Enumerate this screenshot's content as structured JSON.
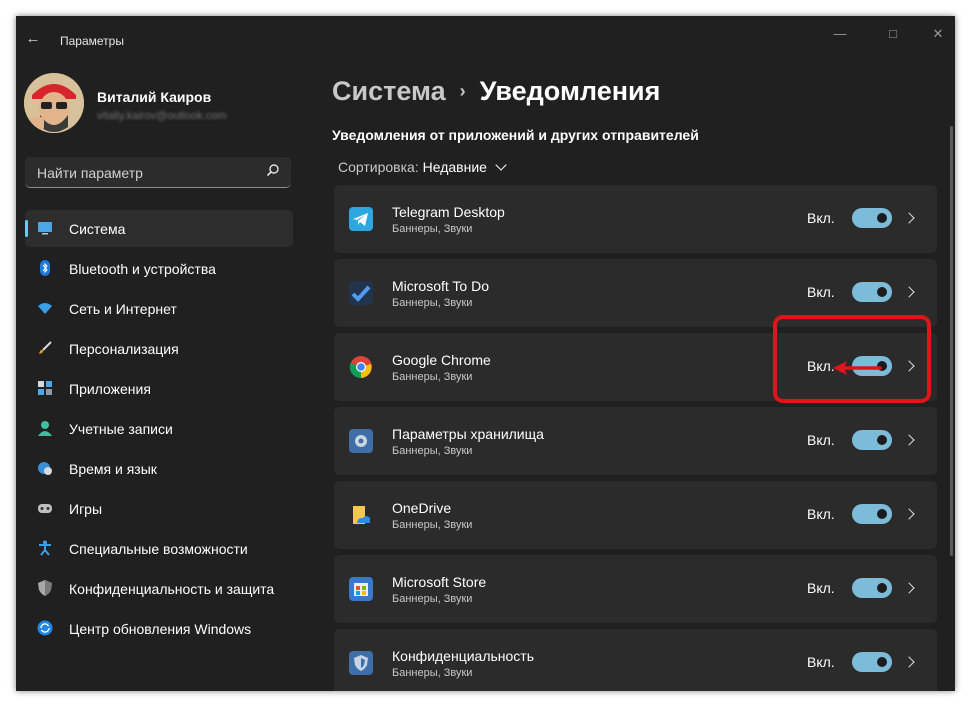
{
  "window": {
    "title": "Параметры"
  },
  "user": {
    "name": "Виталий Каиров",
    "email": "vitaliy.kairov@outlook.com"
  },
  "search": {
    "placeholder": "Найти параметр"
  },
  "nav": [
    {
      "label": "Система",
      "icon": "monitor-icon",
      "active": true
    },
    {
      "label": "Bluetooth и устройства",
      "icon": "bluetooth-icon"
    },
    {
      "label": "Сеть и Интернет",
      "icon": "wifi-icon"
    },
    {
      "label": "Персонализация",
      "icon": "brush-icon"
    },
    {
      "label": "Приложения",
      "icon": "apps-icon"
    },
    {
      "label": "Учетные записи",
      "icon": "person-icon"
    },
    {
      "label": "Время и язык",
      "icon": "globe-clock-icon"
    },
    {
      "label": "Игры",
      "icon": "gamepad-icon"
    },
    {
      "label": "Специальные возможности",
      "icon": "accessibility-icon"
    },
    {
      "label": "Конфиденциальность и защита",
      "icon": "shield-icon"
    },
    {
      "label": "Центр обновления Windows",
      "icon": "update-icon"
    }
  ],
  "breadcrumb": {
    "parent": "Система",
    "current": "Уведомления",
    "separator": "›"
  },
  "section_title": "Уведомления от приложений и других отправителей",
  "sort": {
    "label": "Сортировка:",
    "value": "Недавние"
  },
  "apps": [
    {
      "name": "Telegram Desktop",
      "sub": "Баннеры, Звуки",
      "state": "Вкл.",
      "on": true,
      "icon": "telegram-icon"
    },
    {
      "name": "Microsoft To Do",
      "sub": "Баннеры, Звуки",
      "state": "Вкл.",
      "on": true,
      "icon": "todo-icon"
    },
    {
      "name": "Google Chrome",
      "sub": "Баннеры, Звуки",
      "state": "Вкл.",
      "on": true,
      "icon": "chrome-icon"
    },
    {
      "name": "Параметры хранилища",
      "sub": "Баннеры, Звуки",
      "state": "Вкл.",
      "on": true,
      "icon": "storage-gear-icon"
    },
    {
      "name": "OneDrive",
      "sub": "Баннеры, Звуки",
      "state": "Вкл.",
      "on": true,
      "icon": "onedrive-icon"
    },
    {
      "name": "Microsoft Store",
      "sub": "Баннеры, Звуки",
      "state": "Вкл.",
      "on": true,
      "icon": "store-icon"
    },
    {
      "name": "Конфиденциальность",
      "sub": "Баннеры, Звуки",
      "state": "Вкл.",
      "on": true,
      "icon": "privacy-shield-icon"
    }
  ],
  "colors": {
    "accent": "#60cdff",
    "toggle_on": "#7dbcd9",
    "highlight": "#e0141b",
    "bg": "#202020",
    "card": "#2b2b2b"
  }
}
